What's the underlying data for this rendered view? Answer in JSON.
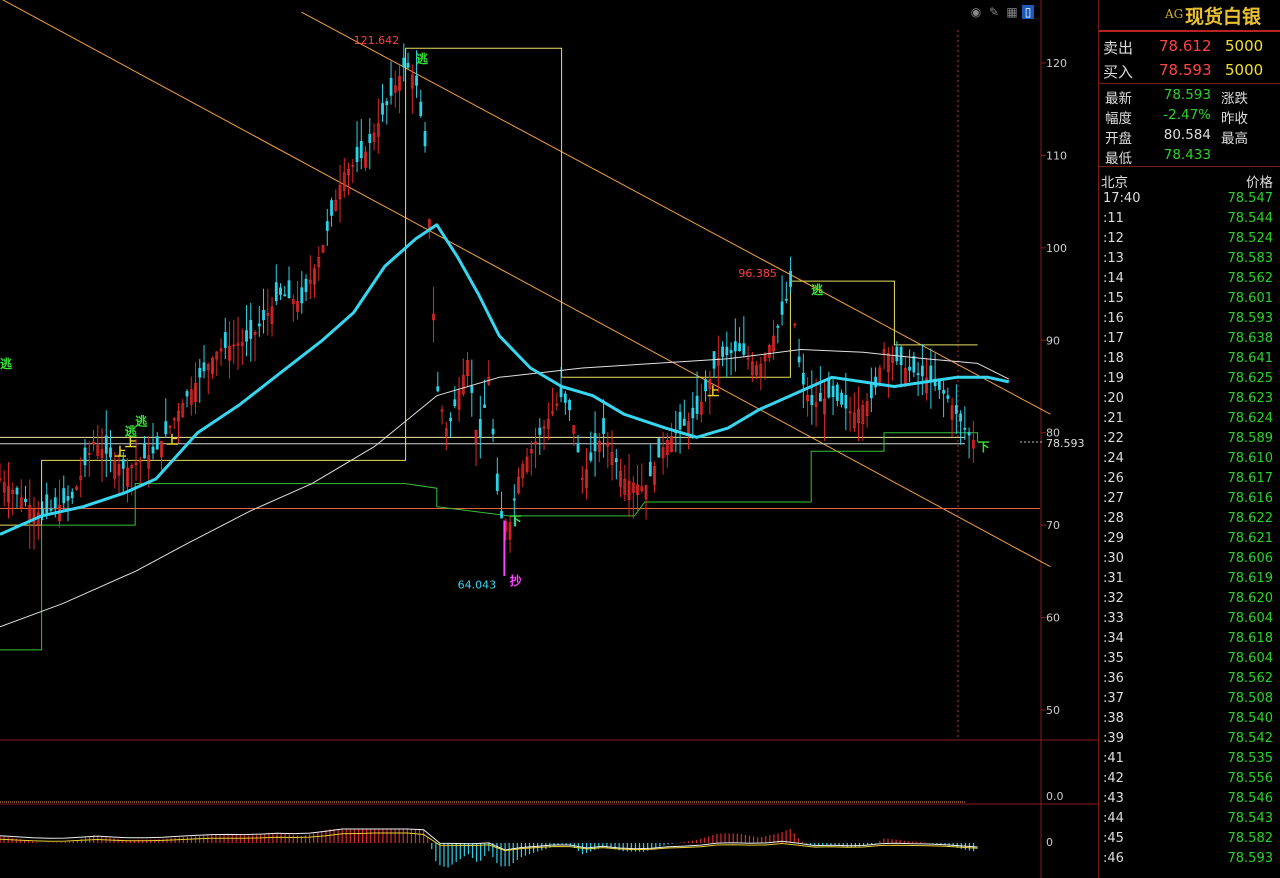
{
  "chart_data": {
    "type": "candlestick",
    "symbol": "AG",
    "x_range": [
      0,
      1
    ],
    "ylim": [
      45,
      125
    ],
    "yticks": [
      50,
      60,
      70,
      80,
      90,
      100,
      110,
      120
    ],
    "colors": {
      "up": "#e02828",
      "down": "#2bd2e8",
      "ma_fast": "#37d6f0",
      "ma_slow": "#e0e0e0",
      "guide_yellow": "#e8e060",
      "guide_green": "#36c036",
      "trend": "#f0a040",
      "pink": "#ff3a3a"
    },
    "ma_fast": [
      [
        0.0,
        69.0
      ],
      [
        0.04,
        71.0
      ],
      [
        0.08,
        72.0
      ],
      [
        0.12,
        73.5
      ],
      [
        0.15,
        75.0
      ],
      [
        0.19,
        80.0
      ],
      [
        0.23,
        83.0
      ],
      [
        0.27,
        86.5
      ],
      [
        0.31,
        90.0
      ],
      [
        0.34,
        93.0
      ],
      [
        0.37,
        98.0
      ],
      [
        0.4,
        101.0
      ],
      [
        0.42,
        102.5
      ],
      [
        0.44,
        99.0
      ],
      [
        0.46,
        95.0
      ],
      [
        0.48,
        90.5
      ],
      [
        0.51,
        87.0
      ],
      [
        0.54,
        85.0
      ],
      [
        0.57,
        84.0
      ],
      [
        0.6,
        82.0
      ],
      [
        0.64,
        80.5
      ],
      [
        0.67,
        79.5
      ],
      [
        0.7,
        80.5
      ],
      [
        0.73,
        82.5
      ],
      [
        0.77,
        84.5
      ],
      [
        0.8,
        86.0
      ],
      [
        0.83,
        85.5
      ],
      [
        0.86,
        85.0
      ],
      [
        0.89,
        85.5
      ],
      [
        0.92,
        86.0
      ],
      [
        0.95,
        86.0
      ],
      [
        0.97,
        85.5
      ]
    ],
    "ma_slow": [
      [
        0.0,
        59.0
      ],
      [
        0.06,
        61.5
      ],
      [
        0.13,
        65.0
      ],
      [
        0.18,
        68.0
      ],
      [
        0.24,
        71.5
      ],
      [
        0.3,
        74.5
      ],
      [
        0.36,
        78.5
      ],
      [
        0.42,
        84.0
      ],
      [
        0.48,
        86.0
      ],
      [
        0.56,
        87.0
      ],
      [
        0.63,
        87.5
      ],
      [
        0.7,
        88.0
      ],
      [
        0.77,
        89.0
      ],
      [
        0.83,
        88.7
      ],
      [
        0.89,
        88.0
      ],
      [
        0.94,
        87.5
      ],
      [
        0.97,
        85.8
      ]
    ],
    "upper_line": [
      [
        0.0,
        70.0
      ],
      [
        0.04,
        70.0
      ],
      [
        0.04,
        77.0
      ],
      [
        0.39,
        77.0
      ],
      [
        0.39,
        121.6
      ],
      [
        0.54,
        121.6
      ],
      [
        0.54,
        86.0
      ],
      [
        0.76,
        86.0
      ],
      [
        0.76,
        96.4
      ],
      [
        0.86,
        96.4
      ],
      [
        0.86,
        89.5
      ],
      [
        0.94,
        89.5
      ]
    ],
    "lower_line": [
      [
        0.0,
        56.5
      ],
      [
        0.04,
        56.5
      ],
      [
        0.04,
        70.0
      ],
      [
        0.13,
        70.0
      ],
      [
        0.13,
        74.5
      ],
      [
        0.39,
        74.5
      ],
      [
        0.42,
        74.0
      ],
      [
        0.42,
        72.0
      ],
      [
        0.49,
        71.0
      ],
      [
        0.61,
        71.0
      ],
      [
        0.62,
        72.5
      ],
      [
        0.78,
        72.5
      ],
      [
        0.78,
        78.0
      ],
      [
        0.85,
        78.0
      ],
      [
        0.85,
        80.0
      ],
      [
        0.94,
        80.0
      ],
      [
        0.94,
        79.0
      ]
    ],
    "trend_lines": [
      {
        "from": [
          0.0,
          127.0
        ],
        "to": [
          1.01,
          65.5
        ]
      },
      {
        "from": [
          0.29,
          125.5
        ],
        "to": [
          1.01,
          82.0
        ]
      }
    ],
    "h_lines": [
      {
        "y": 79.5,
        "color": "#f0e8a0"
      },
      {
        "y": 78.8,
        "color": "#cfcfcf"
      },
      {
        "y": 71.8,
        "color": "#e06040"
      }
    ],
    "extremes": [
      {
        "label": "121.642",
        "x": 0.39,
        "y": 121.6,
        "color": "#ff4040"
      },
      {
        "label": "96.385",
        "x": 0.76,
        "y": 96.4,
        "color": "#ff4040"
      },
      {
        "label": "64.043",
        "x": 0.49,
        "y": 64.0,
        "color": "#37d6f0"
      }
    ],
    "signals": [
      {
        "text": "逃",
        "x": 0.4,
        "y": 120.0,
        "color": "#36e036"
      },
      {
        "text": "逃",
        "x": 0.12,
        "y": 79.7,
        "color": "#36e036"
      },
      {
        "text": "逃",
        "x": 0.13,
        "y": 80.8,
        "color": "#36e036"
      },
      {
        "text": "逃",
        "x": 0.0,
        "y": 87.0,
        "color": "#36e036"
      },
      {
        "text": "逃",
        "x": 0.78,
        "y": 95.0,
        "color": "#36e036"
      },
      {
        "text": "上",
        "x": 0.11,
        "y": 77.5,
        "color": "#e8d030"
      },
      {
        "text": "上",
        "x": 0.12,
        "y": 78.5,
        "color": "#e8d030"
      },
      {
        "text": "上",
        "x": 0.16,
        "y": 78.8,
        "color": "#e8d030"
      },
      {
        "text": "上",
        "x": 0.68,
        "y": 84.0,
        "color": "#e8d030"
      },
      {
        "text": "下",
        "x": 0.49,
        "y": 70.0,
        "color": "#36e036"
      },
      {
        "text": "下",
        "x": 0.94,
        "y": 78.0,
        "color": "#36e036"
      },
      {
        "text": "抄",
        "x": 0.49,
        "y": 63.5,
        "color": "#ff40ff"
      }
    ],
    "current_price": "78.593",
    "sub_axis_labels": [
      "0.0",
      "0"
    ]
  },
  "toolbar": {
    "icons": [
      "eye-icon",
      "edit-icon",
      "grid-icon",
      "window-icon"
    ]
  },
  "quote": {
    "code": "AG",
    "name": "现货白银",
    "sell_label": "卖出",
    "sell_price": "78.612",
    "sell_vol": "5000",
    "buy_label": "买入",
    "buy_price": "78.593",
    "buy_vol": "5000",
    "rows": [
      {
        "k": "最新",
        "v": "78.593",
        "k2": "涨跌",
        "color": "#2bd12b"
      },
      {
        "k": "幅度",
        "v": "-2.47%",
        "k2": "昨收",
        "color": "#2bd12b"
      },
      {
        "k": "开盘",
        "v": "80.584",
        "k2": "最高",
        "color": "#dddddd"
      },
      {
        "k": "最低",
        "v": "78.433",
        "k2": "",
        "color": "#2bd12b"
      }
    ]
  },
  "ticks": {
    "head_left": "北京",
    "head_right": "价格",
    "rows": [
      {
        "t": "17:40",
        "p": "78.547"
      },
      {
        "t": ":11",
        "p": "78.544"
      },
      {
        "t": ":12",
        "p": "78.524"
      },
      {
        "t": ":13",
        "p": "78.583"
      },
      {
        "t": ":14",
        "p": "78.562"
      },
      {
        "t": ":15",
        "p": "78.601"
      },
      {
        "t": ":16",
        "p": "78.593"
      },
      {
        "t": ":17",
        "p": "78.638"
      },
      {
        "t": ":18",
        "p": "78.641"
      },
      {
        "t": ":19",
        "p": "78.625"
      },
      {
        "t": ":20",
        "p": "78.623"
      },
      {
        "t": ":21",
        "p": "78.624"
      },
      {
        "t": ":22",
        "p": "78.589"
      },
      {
        "t": ":24",
        "p": "78.610"
      },
      {
        "t": ":26",
        "p": "78.617"
      },
      {
        "t": ":27",
        "p": "78.616"
      },
      {
        "t": ":28",
        "p": "78.622"
      },
      {
        "t": ":29",
        "p": "78.621"
      },
      {
        "t": ":30",
        "p": "78.606"
      },
      {
        "t": ":31",
        "p": "78.619"
      },
      {
        "t": ":32",
        "p": "78.620"
      },
      {
        "t": ":33",
        "p": "78.604"
      },
      {
        "t": ":34",
        "p": "78.618"
      },
      {
        "t": ":35",
        "p": "78.604"
      },
      {
        "t": ":36",
        "p": "78.562"
      },
      {
        "t": ":37",
        "p": "78.508"
      },
      {
        "t": ":38",
        "p": "78.540"
      },
      {
        "t": ":39",
        "p": "78.542"
      },
      {
        "t": ":41",
        "p": "78.535"
      },
      {
        "t": ":42",
        "p": "78.556"
      },
      {
        "t": ":43",
        "p": "78.546"
      },
      {
        "t": ":44",
        "p": "78.543"
      },
      {
        "t": ":45",
        "p": "78.582"
      },
      {
        "t": ":46",
        "p": "78.593"
      }
    ]
  }
}
